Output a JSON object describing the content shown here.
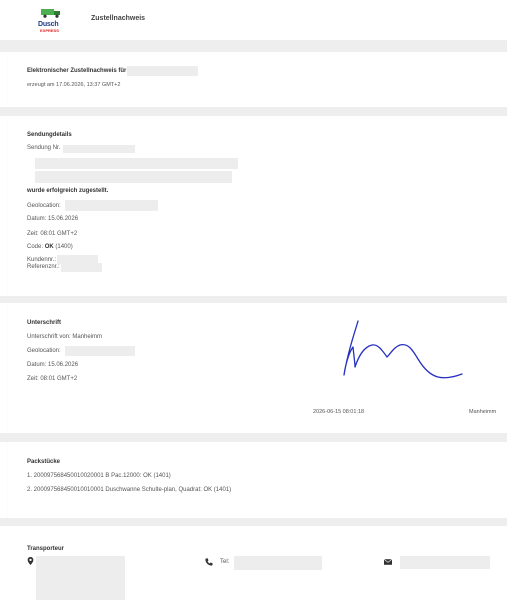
{
  "header": {
    "logo_brand": "Dusch",
    "logo_sub": "EXPRESS",
    "title": "Zustellnachweis"
  },
  "proof": {
    "heading": "Elektronischer Zustellnachweis für",
    "generated": "erzeugt am 17.06.2026, 13:37 GMT+2"
  },
  "shipment": {
    "heading": "Sendungdetails",
    "number_label": "Sendung Nr.",
    "delivered_text": "wurde erfolgreich zugestellt.",
    "geolocation_label": "Geolocation:",
    "date": "Datum: 15.06.2026",
    "time": "Zeit: 08:01 GMT+2",
    "code_label": "Code:",
    "code_value": "OK",
    "code_number": "(1400)",
    "customer_label": "Kundennr.:",
    "reference_label": "Referenznr.:"
  },
  "signature": {
    "heading": "Unterschrift",
    "signed_by": "Unterschrift von: Manheimm",
    "geolocation_label": "Geolocation:",
    "date": "Datum: 15.06.2026",
    "time": "Zeit: 08:01 GMT+2",
    "timestamp": "2026-06-15 08:01:18",
    "signer_name": "Manheimm"
  },
  "packages": {
    "heading": "Packstücke",
    "items": [
      "1. 200097568450010020001 B Pac.12000: OK (1401)",
      "2. 200097568450010010001 Duschwanne Schulte-plan, Quadrat: OK (1401)"
    ]
  },
  "carrier": {
    "heading": "Transporteur",
    "tel_label": "Tel:"
  },
  "icons": {
    "location": "map-marker-icon",
    "phone": "phone-icon",
    "mail": "envelope-icon"
  }
}
